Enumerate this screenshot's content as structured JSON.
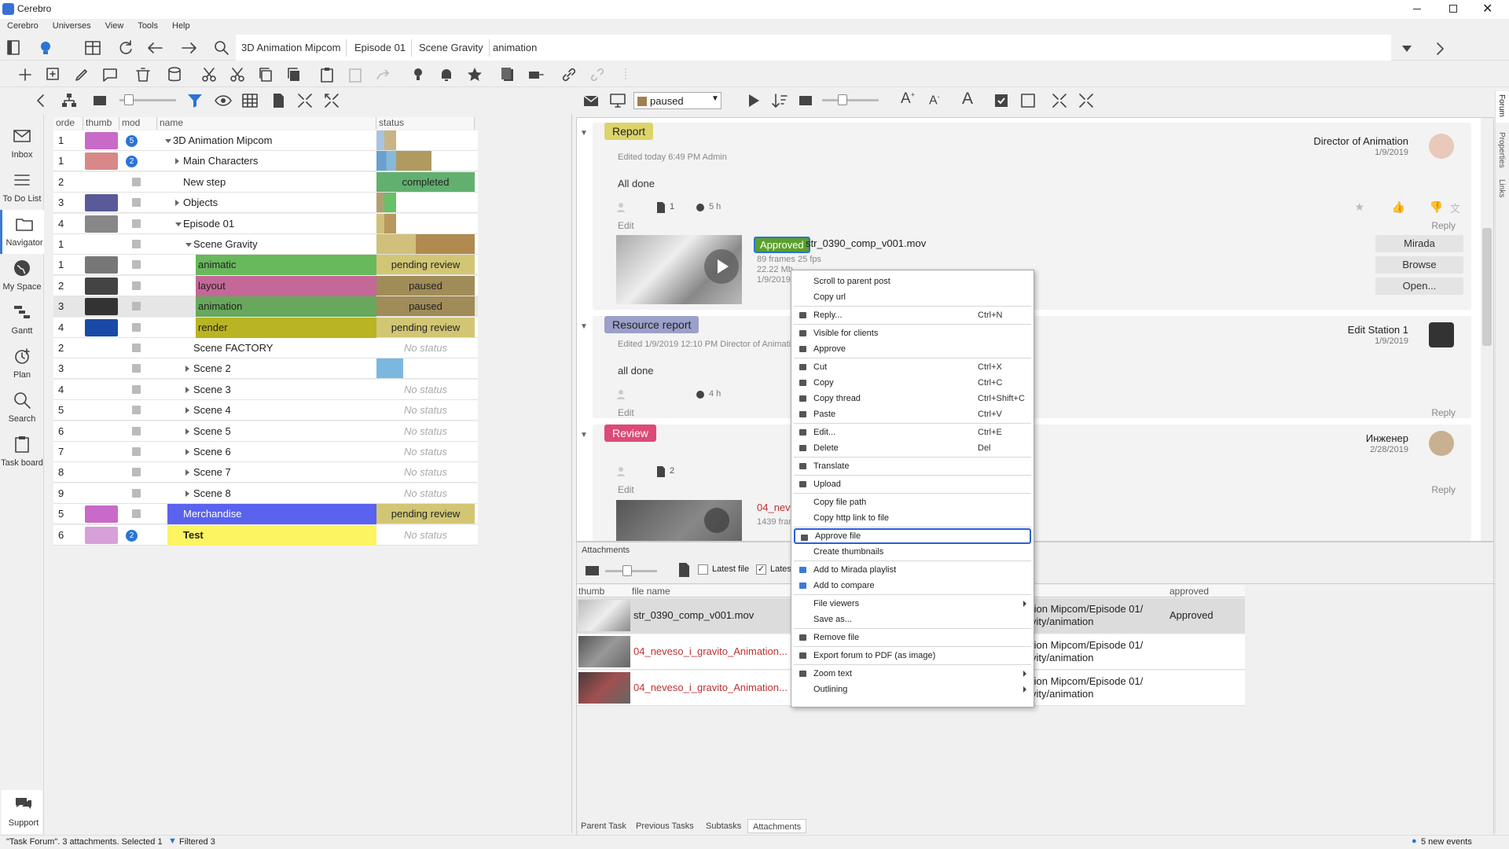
{
  "app": {
    "title": "Cerebro"
  },
  "menu": [
    "Cerebro",
    "Universes",
    "View",
    "Tools",
    "Help"
  ],
  "toolbar": {
    "bulb_count": "5",
    "breadcrumbs": [
      "3D Animation Mipcom",
      "Episode 01",
      "Scene Gravity",
      "animation"
    ]
  },
  "sidebar": [
    {
      "label": "Inbox",
      "icon": "mail-icon"
    },
    {
      "label": "To Do List",
      "icon": "list-icon"
    },
    {
      "label": "Navigator",
      "icon": "folder-icon"
    },
    {
      "label": "My Space",
      "icon": "globe-icon"
    },
    {
      "label": "Gantt",
      "icon": "gantt-icon"
    },
    {
      "label": "Plan",
      "icon": "clock-icon"
    },
    {
      "label": "Search",
      "icon": "search-icon"
    },
    {
      "label": "Task board",
      "icon": "clipboard-icon"
    },
    {
      "label": "Support",
      "icon": "chat-icon"
    }
  ],
  "tree": {
    "headers": {
      "order": "orde",
      "thumb": "thumb",
      "mod": "mod",
      "name": "name",
      "status": "status"
    },
    "rows": [
      {
        "order": "1",
        "name": "3D Animation Mipcom",
        "status": "",
        "badge": "5",
        "indent": 0,
        "exp": "down"
      },
      {
        "order": "1",
        "name": "Main Characters",
        "status": "",
        "badge": "2",
        "indent": 1,
        "exp": "right"
      },
      {
        "order": "2",
        "name": "New step",
        "status": "completed",
        "indent": 1,
        "exp": ""
      },
      {
        "order": "3",
        "name": "Objects",
        "status": "",
        "indent": 1,
        "exp": "right"
      },
      {
        "order": "4",
        "name": "Episode 01",
        "status": "",
        "indent": 1,
        "exp": "down"
      },
      {
        "order": "1",
        "name": "Scene Gravity",
        "status": "",
        "indent": 2,
        "exp": "down"
      },
      {
        "order": "1",
        "name": "animatic",
        "status": "pending review",
        "indent": 3,
        "exp": ""
      },
      {
        "order": "2",
        "name": "layout",
        "status": "paused",
        "indent": 3,
        "exp": ""
      },
      {
        "order": "3",
        "name": "animation",
        "status": "paused",
        "indent": 3,
        "exp": ""
      },
      {
        "order": "4",
        "name": "render",
        "status": "pending review",
        "indent": 3,
        "exp": ""
      },
      {
        "order": "2",
        "name": "Scene FACTORY",
        "status": "No status",
        "indent": 2,
        "exp": ""
      },
      {
        "order": "3",
        "name": "Scene 2",
        "status": "",
        "indent": 2,
        "exp": "right"
      },
      {
        "order": "4",
        "name": "Scene 3",
        "status": "No status",
        "indent": 2,
        "exp": "right"
      },
      {
        "order": "5",
        "name": "Scene 4",
        "status": "No status",
        "indent": 2,
        "exp": "right"
      },
      {
        "order": "6",
        "name": "Scene 5",
        "status": "No status",
        "indent": 2,
        "exp": "right"
      },
      {
        "order": "7",
        "name": "Scene 6",
        "status": "No status",
        "indent": 2,
        "exp": "right"
      },
      {
        "order": "8",
        "name": "Scene 7",
        "status": "No status",
        "indent": 2,
        "exp": "right"
      },
      {
        "order": "9",
        "name": "Scene 8",
        "status": "No status",
        "indent": 2,
        "exp": "right"
      },
      {
        "order": "5",
        "name": "Merchandise",
        "status": "pending review",
        "indent": 1,
        "exp": ""
      },
      {
        "order": "6",
        "name": "Test",
        "status": "No status",
        "badge": "2",
        "indent": 1,
        "exp": "right"
      }
    ]
  },
  "forum": {
    "filter": "paused",
    "posts": [
      {
        "tag": "Report",
        "meta": "Edited today 6:49 PM  Admin",
        "text": "All done",
        "author": "Director of Animation",
        "date": "1/9/2019",
        "files": "1",
        "hours": "5 h",
        "edit": "Edit",
        "reply": "Reply",
        "attachment": {
          "badge": "Approved",
          "name": "str_0390_comp_v001.mov",
          "info1": "89 frames 25 fps",
          "info2": "22.22 Mb",
          "info3": "1/9/2019 12:"
        },
        "buttons": [
          "Mirada",
          "Browse",
          "Open..."
        ]
      },
      {
        "tag": "Resource report",
        "meta": "Edited 1/9/2019 12:10 PM   Director of Animation",
        "text": "all done",
        "author": "Edit Station 1",
        "date": "1/9/2019",
        "hours": "4 h",
        "edit": "Edit",
        "reply": "Reply"
      },
      {
        "tag": "Review",
        "author": "Инженер",
        "date": "2/28/2019",
        "files": "2",
        "edit": "Edit",
        "reply": "Reply",
        "attachment": {
          "name": "04_neveso_",
          "info1": "1439 frame"
        }
      }
    ]
  },
  "context_menu": [
    {
      "label": "Scroll to parent post"
    },
    {
      "label": "Copy url",
      "sep": true
    },
    {
      "label": "Reply...",
      "shortcut": "Ctrl+N",
      "sep": true
    },
    {
      "label": "Visible for clients"
    },
    {
      "label": "Approve",
      "sep": true
    },
    {
      "label": "Cut",
      "shortcut": "Ctrl+X"
    },
    {
      "label": "Copy",
      "shortcut": "Ctrl+C"
    },
    {
      "label": "Copy thread",
      "shortcut": "Ctrl+Shift+C"
    },
    {
      "label": "Paste",
      "shortcut": "Ctrl+V",
      "sep": true
    },
    {
      "label": "Edit...",
      "shortcut": "Ctrl+E"
    },
    {
      "label": "Delete",
      "shortcut": "Del",
      "sep": true
    },
    {
      "label": "Translate",
      "sep": true
    },
    {
      "label": "Upload",
      "sep": true
    },
    {
      "label": "Copy file path"
    },
    {
      "label": "Copy http link to file",
      "sep": true
    },
    {
      "label": "Approve file",
      "highlight": true
    },
    {
      "label": "Create thumbnails",
      "sep": true
    },
    {
      "label": "Add to Mirada playlist"
    },
    {
      "label": "Add to compare",
      "sep": true
    },
    {
      "label": "File viewers",
      "submenu": true
    },
    {
      "label": "Save as...",
      "sep": true
    },
    {
      "label": "Remove file",
      "sep": true
    },
    {
      "label": "Export forum to PDF (as image)",
      "sep": true
    },
    {
      "label": "Zoom text",
      "submenu": true
    },
    {
      "label": "Outlining",
      "submenu": true
    }
  ],
  "attachments": {
    "title": "Attachments",
    "latest_file": "Latest file",
    "latest2": "Lates",
    "headers": {
      "thumb": "thumb",
      "file_name": "file name",
      "approved": "approved"
    },
    "rows": [
      {
        "name": "str_0390_comp_v001.mov",
        "path1": "tion Mipcom/Episode 01/",
        "path2": "vity/animation",
        "approved": "Approved"
      },
      {
        "name": "04_neveso_i_gravito_Animation...",
        "path1": "tion Mipcom/Episode 01/",
        "path2": "vity/animation",
        "approved": ""
      },
      {
        "name": "04_neveso_i_gravito_Animation...",
        "path1": "tion Mipcom/Episode 01/",
        "path2": "vity/animation",
        "approved": ""
      }
    ]
  },
  "bottom_tabs": [
    "Parent Task",
    "Previous Tasks",
    "Subtasks",
    "Attachments"
  ],
  "right_side_tabs": [
    "Forum",
    "Properties",
    "Links"
  ],
  "status": {
    "left": "\"Task Forum\". 3 attachments. Selected 1",
    "filtered": "Filtered 3",
    "events": "5 new events"
  }
}
